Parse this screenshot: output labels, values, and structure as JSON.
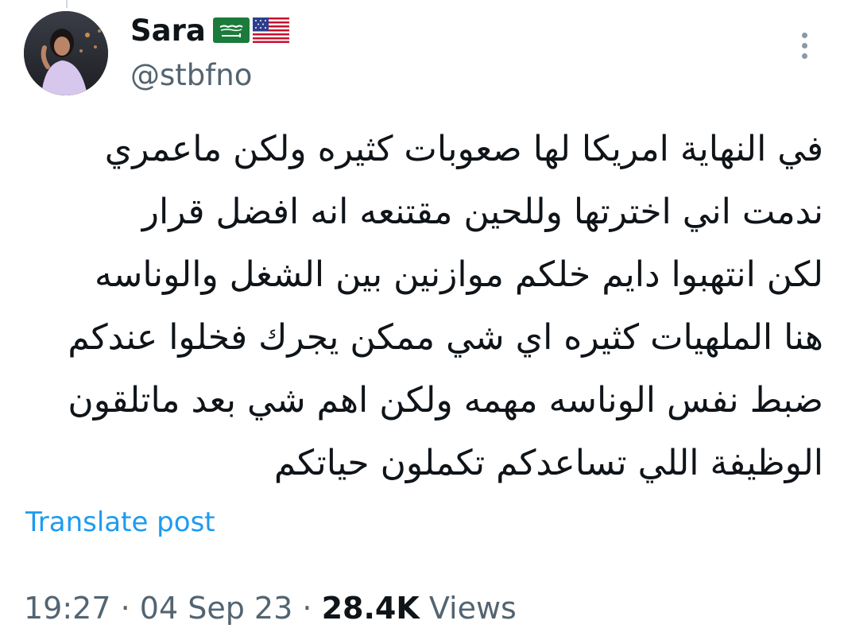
{
  "author": {
    "name": "Sara",
    "handle": "@stbfno",
    "flags": [
      "saudi-arabia-flag",
      "united-states-flag"
    ]
  },
  "tweet": {
    "lines": [
      "في النهاية امريكا لها صعوبات كثيره ولكن ماعمري",
      "ندمت اني اخترتها وللحين مقتنعه انه افضل قرار",
      "لكن انتهبوا دايم خلكم موازنين بين الشغل والوناسه",
      "هنا الملهيات كثيره اي شي ممكن يجرك فخلوا عندكم",
      "ضبط نفس الوناسه مهمه ولكن اهم شي بعد ماتلقون",
      "الوظيفة اللي تساعدكم تكملون حياتكم"
    ],
    "translate_label": "Translate post"
  },
  "meta": {
    "time": "19:27",
    "separator": "·",
    "date": "04 Sep 23",
    "views_count": "28.4K",
    "views_label": "Views"
  },
  "colors": {
    "accent": "#1d9bf0",
    "secondary_text": "#536471",
    "primary_text": "#0f1419"
  },
  "icons": {
    "more": "more-vertical-icon"
  }
}
